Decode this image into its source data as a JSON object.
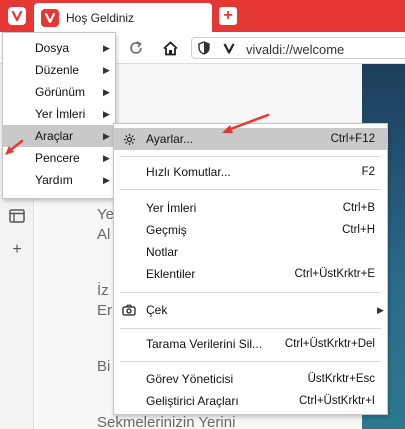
{
  "tab": {
    "title": "Hoş Geldiniz"
  },
  "address": {
    "url": "vivaldi://welcome"
  },
  "page_text": {
    "line1": "Ye",
    "line2": "Al",
    "line3": "İz",
    "line4": "Er",
    "line5": "Bi",
    "line6": "Sekmelerinizin Yerini"
  },
  "main_menu": {
    "items": [
      {
        "label": "Dosya"
      },
      {
        "label": "Düzenle"
      },
      {
        "label": "Görünüm"
      },
      {
        "label": "Yer İmleri"
      },
      {
        "label": "Araçlar"
      },
      {
        "label": "Pencere"
      },
      {
        "label": "Yardım"
      }
    ]
  },
  "tools_menu": {
    "items": [
      {
        "label": "Ayarlar...",
        "shortcut": "Ctrl+F12"
      },
      {
        "label": "Hızlı Komutlar...",
        "shortcut": "F2"
      },
      {
        "label": "Yer İmleri",
        "shortcut": "Ctrl+B"
      },
      {
        "label": "Geçmiş",
        "shortcut": "Ctrl+H"
      },
      {
        "label": "Notlar",
        "shortcut": ""
      },
      {
        "label": "Eklentiler",
        "shortcut": "Ctrl+ÜstKrktr+E"
      },
      {
        "label": "Çek",
        "shortcut": ""
      },
      {
        "label": "Tarama Verilerini Sil...",
        "shortcut": "Ctrl+ÜstKrktr+Del"
      },
      {
        "label": "Görev Yöneticisi",
        "shortcut": "ÜstKrktr+Esc"
      },
      {
        "label": "Geliştirici Araçları",
        "shortcut": "Ctrl+ÜstKrktr+I"
      }
    ]
  },
  "colors": {
    "brand_red": "#e53835",
    "highlight": "#c9c9c9"
  }
}
